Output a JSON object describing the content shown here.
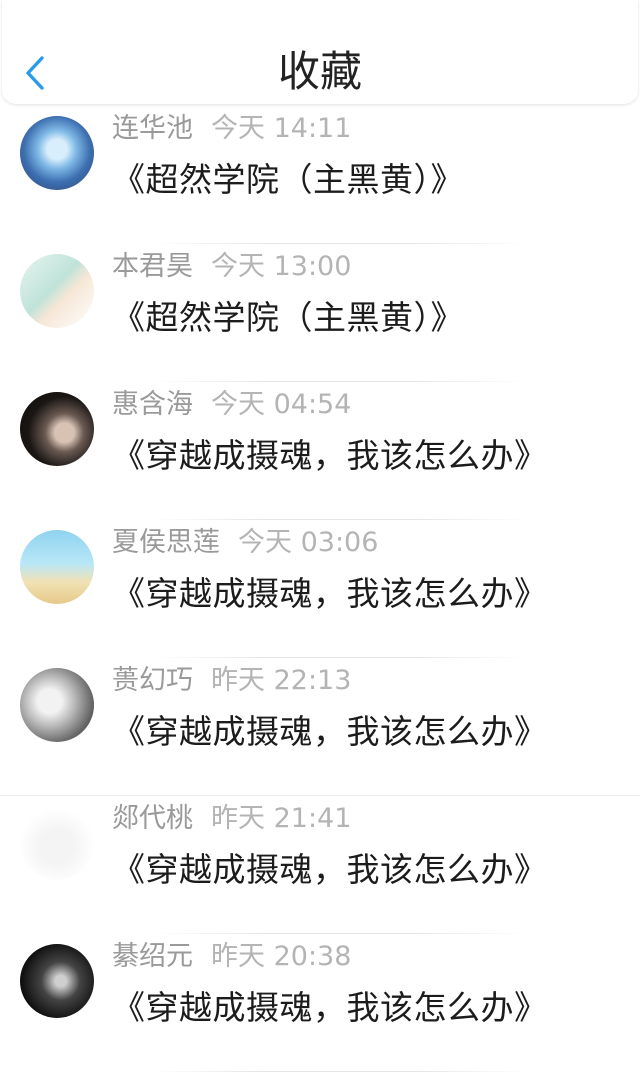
{
  "header": {
    "title": "收藏",
    "back_icon": "chevron-left-icon",
    "accent_color": "#2a9be8"
  },
  "items": [
    {
      "name": "连华池",
      "time": "今天 14:11",
      "title": "《超然学院（主黑黄）》"
    },
    {
      "name": "本君昊",
      "time": "今天 13:00",
      "title": "《超然学院（主黑黄）》"
    },
    {
      "name": "惠含海",
      "time": "今天 04:54",
      "title": "《穿越成摄魂，我该怎么办》"
    },
    {
      "name": "夏侯思莲",
      "time": "今天 03:06",
      "title": "《穿越成摄魂，我该怎么办》"
    },
    {
      "name": "蒉幻巧",
      "time": "昨天 22:13",
      "title": "《穿越成摄魂，我该怎么办》"
    },
    {
      "name": "郯代桃",
      "time": "昨天 21:41",
      "title": "《穿越成摄魂，我该怎么办》"
    },
    {
      "name": "綦绍元",
      "time": "昨天 20:38",
      "title": "《穿越成摄魂，我该怎么办》"
    }
  ]
}
